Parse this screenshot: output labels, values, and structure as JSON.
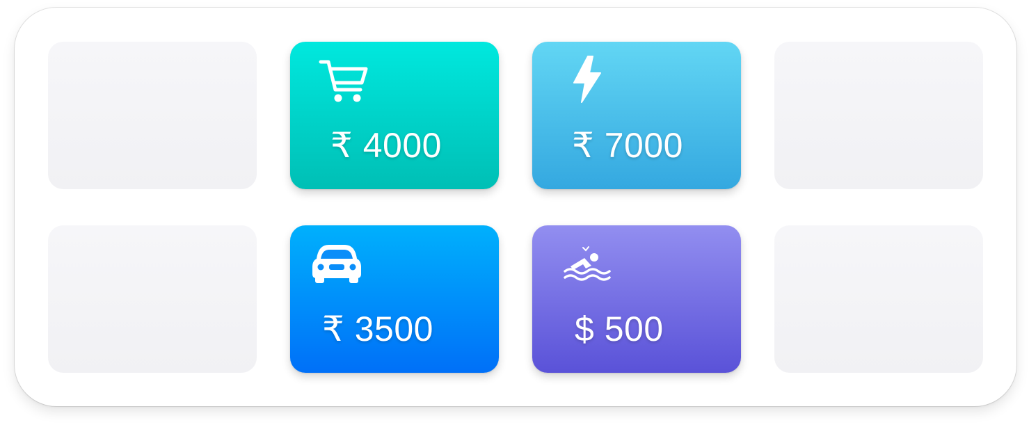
{
  "cards": [
    {
      "icon": "shopping-cart-icon",
      "amount": "₹ 4000",
      "color_top": "#00e8de",
      "color_bottom": "#00bfb5"
    },
    {
      "icon": "lightning-bolt-icon",
      "amount": "₹ 7000",
      "color_top": "#62d6f4",
      "color_bottom": "#34a8e0"
    },
    {
      "icon": "car-icon",
      "amount": "₹ 3500",
      "color_top": "#00b0fc",
      "color_bottom": "#0070f8"
    },
    {
      "icon": "swimmer-icon",
      "amount": "$ 500",
      "color_top": "#928ef0",
      "color_bottom": "#5a52d8"
    }
  ]
}
